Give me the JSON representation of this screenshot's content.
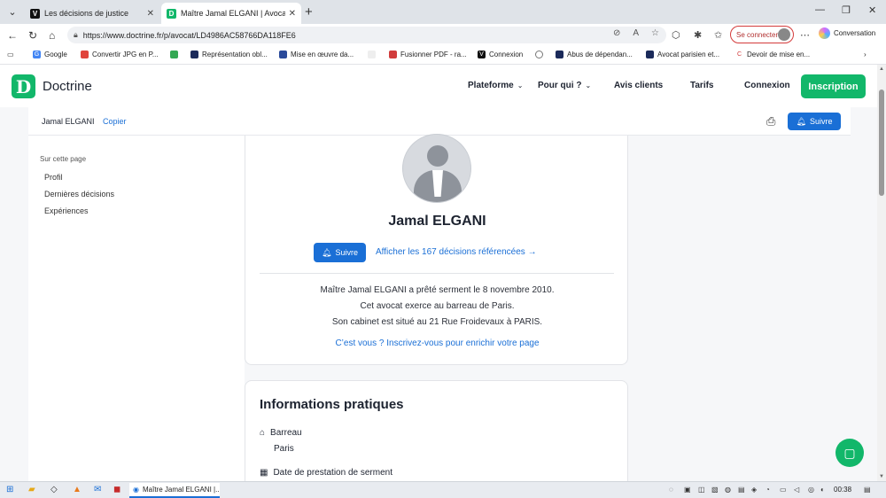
{
  "browser": {
    "tabs": [
      {
        "label": "Les décisions de justice",
        "favicon": "V",
        "favicon_color": "#111111"
      },
      {
        "label": "Maître Jamal ELGANI | Avocat Paris",
        "favicon": "D",
        "favicon_color": "#12b76a"
      }
    ],
    "url": "https://www.doctrine.fr/p/avocat/LD4986AC58766DA118FE6",
    "connect_label": "Se connecter",
    "conversation_label": "Conversation",
    "bookmarks": [
      {
        "label": "Google",
        "icon": "G"
      },
      {
        "label": "Convertir JPG en P...",
        "icon": "C"
      },
      {
        "label": "",
        "icon": "maps"
      },
      {
        "label": "Représentation obl...",
        "icon": "R"
      },
      {
        "label": "Mise en œuvre da...",
        "icon": "M"
      },
      {
        "label": "",
        "icon": "blank"
      },
      {
        "label": "Fusionner PDF - ra...",
        "icon": "F"
      },
      {
        "label": "Connexion",
        "icon": "V"
      },
      {
        "label": "",
        "icon": "globe"
      },
      {
        "label": "Connexion",
        "icon": "globe"
      },
      {
        "label": "Abus de dépendan...",
        "icon": "A"
      },
      {
        "label": "Avocat parisien et...",
        "icon": "A"
      },
      {
        "label": "Devoir de mise en...",
        "icon": "C"
      }
    ]
  },
  "site": {
    "brand": "Doctrine",
    "brand_letter": "D",
    "nav": {
      "plateforme": "Plateforme",
      "pour_qui": "Pour qui ?",
      "avis": "Avis clients",
      "tarifs": "Tarifs",
      "connexion": "Connexion",
      "inscription": "Inscription"
    },
    "subheader": {
      "name": "Jamal ELGANI",
      "copy": "Copier",
      "follow": "Suivre"
    },
    "sidebar": {
      "heading": "Sur cette page",
      "items": [
        "Profil",
        "Dernières décisions",
        "Expériences"
      ]
    },
    "profile": {
      "name": "Jamal ELGANI",
      "follow": "Suivre",
      "decisions_link": "Afficher les 167 décisions référencées",
      "desc_lines": [
        "Maître Jamal ELGANI a prêté serment le 8 novembre 2010.",
        "Cet avocat exerce au barreau de Paris.",
        "Son cabinet est situé au 21 Rue Froidevaux à PARIS."
      ],
      "claim": "C’est vous ? Inscrivez-vous pour enrichir votre page"
    },
    "info": {
      "title": "Informations pratiques",
      "barreau_label": "Barreau",
      "barreau_value": "Paris",
      "serment_label": "Date de prestation de serment"
    }
  },
  "taskbar": {
    "app_label": "Maître Jamal ELGANI |...",
    "time": "00:38"
  },
  "colors": {
    "brand_green": "#12b76a",
    "link_blue": "#1a6fd6"
  }
}
